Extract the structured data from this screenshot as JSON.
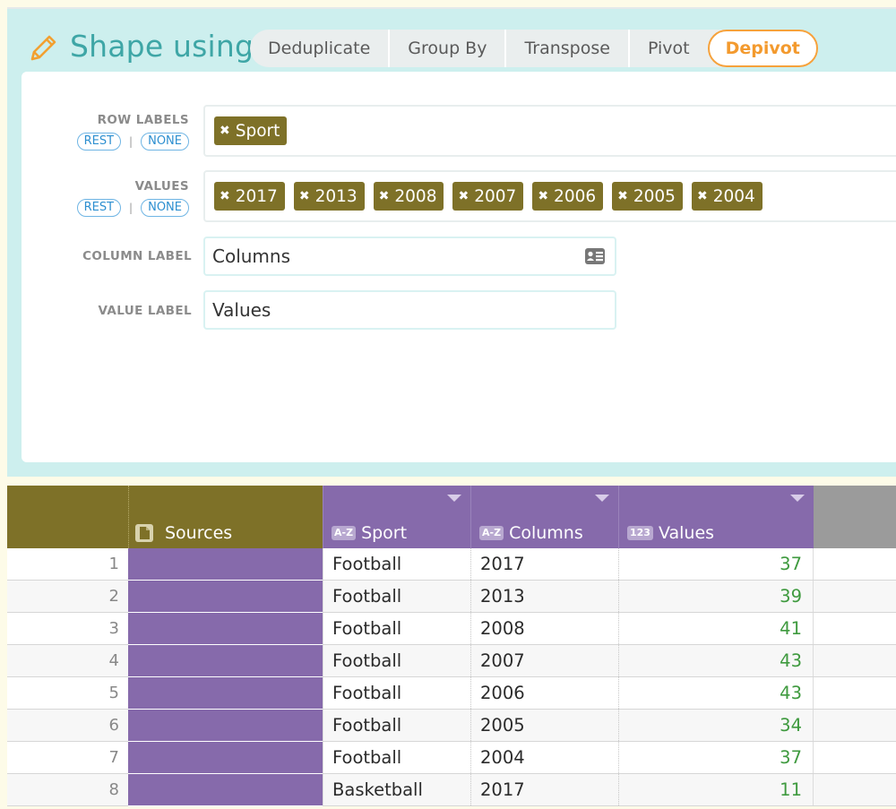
{
  "shape": {
    "title": "Shape using",
    "tabs": [
      {
        "label": "Deduplicate",
        "active": false
      },
      {
        "label": "Group By",
        "active": false
      },
      {
        "label": "Transpose",
        "active": false
      },
      {
        "label": "Pivot",
        "active": false
      },
      {
        "label": "Depivot",
        "active": true
      }
    ]
  },
  "form": {
    "row_labels": {
      "label": "ROW LABELS",
      "rest": "REST",
      "sep": "|",
      "none": "NONE",
      "tags": [
        "Sport"
      ]
    },
    "values": {
      "label": "VALUES",
      "rest": "REST",
      "sep": "|",
      "none": "NONE",
      "tags": [
        "2017",
        "2013",
        "2008",
        "2007",
        "2006",
        "2005",
        "2004"
      ]
    },
    "column_label": {
      "label": "COLUMN LABEL",
      "value": "Columns"
    },
    "value_label": {
      "label": "VALUE LABEL",
      "value": "Values"
    },
    "tag_remove_glyph": "✖"
  },
  "table": {
    "columns": [
      {
        "name": "Sources",
        "type": ""
      },
      {
        "name": "Sport",
        "type": "A-Z"
      },
      {
        "name": "Columns",
        "type": "A-Z"
      },
      {
        "name": "Values",
        "type": "123"
      }
    ],
    "rows": [
      {
        "index": "1",
        "sport": "Football",
        "column": "2017",
        "value": "37"
      },
      {
        "index": "2",
        "sport": "Football",
        "column": "2013",
        "value": "39"
      },
      {
        "index": "3",
        "sport": "Football",
        "column": "2008",
        "value": "41"
      },
      {
        "index": "4",
        "sport": "Football",
        "column": "2007",
        "value": "43"
      },
      {
        "index": "5",
        "sport": "Football",
        "column": "2006",
        "value": "43"
      },
      {
        "index": "6",
        "sport": "Football",
        "column": "2005",
        "value": "34"
      },
      {
        "index": "7",
        "sport": "Football",
        "column": "2004",
        "value": "37"
      },
      {
        "index": "8",
        "sport": "Basketball",
        "column": "2017",
        "value": "11"
      }
    ]
  },
  "colors": {
    "accent_teal": "#3ea6a6",
    "active_tab": "#f39a2e",
    "tag_olive": "#7e7128",
    "column_purple": "#866aab",
    "value_green": "#3f9a3f"
  },
  "icons": {
    "title": "pencil-icon",
    "column_label_field": "id-card-icon",
    "sources_header": "document-icon",
    "header_menu": "caret-down-icon"
  }
}
